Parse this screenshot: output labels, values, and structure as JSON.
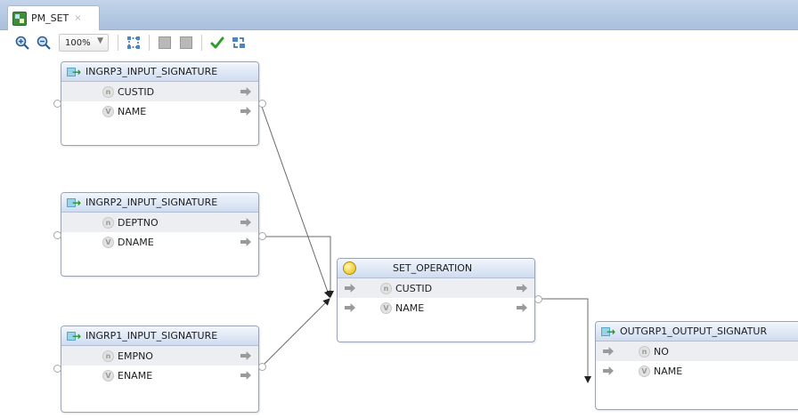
{
  "tab": {
    "title": "PM_SET",
    "close": "×"
  },
  "toolbar": {
    "zoom": "100%"
  },
  "nodes": {
    "ingrp3": {
      "title": "INGRP3_INPUT_SIGNATURE",
      "fields": [
        {
          "badge": "n",
          "name": "CUSTID"
        },
        {
          "badge": "V",
          "name": "NAME"
        }
      ]
    },
    "ingrp2": {
      "title": "INGRP2_INPUT_SIGNATURE",
      "fields": [
        {
          "badge": "n",
          "name": "DEPTNO"
        },
        {
          "badge": "V",
          "name": "DNAME"
        }
      ]
    },
    "ingrp1": {
      "title": "INGRP1_INPUT_SIGNATURE",
      "fields": [
        {
          "badge": "n",
          "name": "EMPNO"
        },
        {
          "badge": "V",
          "name": "ENAME"
        }
      ]
    },
    "set": {
      "title": "SET_OPERATION",
      "fields": [
        {
          "badge": "n",
          "name": "CUSTID"
        },
        {
          "badge": "V",
          "name": "NAME"
        }
      ]
    },
    "out": {
      "title": "OUTGRP1_OUTPUT_SIGNATUR",
      "fields": [
        {
          "badge": "n",
          "name": "NO"
        },
        {
          "badge": "V",
          "name": "NAME"
        }
      ]
    }
  },
  "colors": {
    "tabstrip": "#b7c9e3",
    "node_header": "#d6e2f3",
    "link": "#666666",
    "check": "#2e9c2e"
  },
  "icons": [
    "zoom-in-icon",
    "zoom-out-icon",
    "fit-to-window-icon",
    "layout-icon",
    "auto-layout-icon",
    "validate-check-icon",
    "refresh-icon"
  ]
}
